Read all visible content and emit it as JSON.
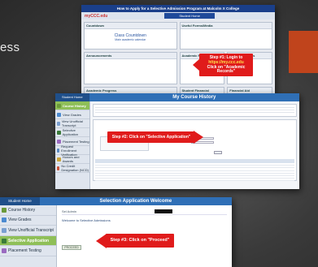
{
  "slide": {
    "partial_text": "ess"
  },
  "shot1": {
    "title": "How to Apply for a Selective Admission Program at Malcolm X College",
    "logo": "myCCC.edu",
    "student_home": "Student Home",
    "panels": {
      "countdown": "Countdown",
      "countdown_title": "Class Countdown",
      "countdown_sub": "Main academic calendar",
      "quick_links": "Useful Forms/Media",
      "announcements": "Announcements",
      "academic_records": "Academic Records",
      "manage_classes": "Manage Classes",
      "academic_progress": "Academic Progress",
      "student_finance": "Student Financial Account",
      "financial_aid": "Financial Aid"
    },
    "callout_line1": "Step #1: Login to",
    "callout_line2": "https://my.ccc.edu",
    "callout_line3": "Click on \"Academic Records\""
  },
  "shot2": {
    "home": "Student Home",
    "title": "My Course History",
    "side_items": [
      "Course History",
      "View Grades",
      "View Unofficial Transcript",
      "Selective Application",
      "Placement Testing",
      "Request Enrollment Verification",
      "Honors and Awards",
      "No Credit Designation (NCD)"
    ],
    "callout": "Step #2: Click on \"Selective Application\""
  },
  "shot3": {
    "home": "Student Home",
    "title": "Selection Application Welcome",
    "side_items": [
      "Course History",
      "View Grades",
      "View Unofficial Transcript",
      "Selective Application",
      "Placement Testing"
    ],
    "row_label": "Sel Admin",
    "welcome": "Welcome to Selective Admissions",
    "proceed": "PROCEED",
    "callout": "Step #3: Click on \"Proceed\""
  },
  "colors": {
    "accent_red": "#e01b1b",
    "header_blue": "#2f6fb6",
    "active_green": "#8fbf58",
    "slide_orange": "#c0441c"
  }
}
